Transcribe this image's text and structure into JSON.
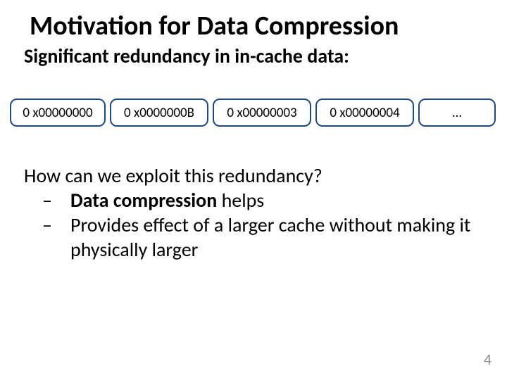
{
  "title": "Motivation for Data Compression",
  "subtitle": "Significant redundancy in in-cache data:",
  "hex_cells": {
    "c0": "0 x00000000",
    "c1": "0 x0000000B",
    "c2": "0 x00000003",
    "c3": "0 x00000004",
    "c4": "…"
  },
  "body": {
    "question": "How can we exploit this redundancy?",
    "bullet1_bold": "Data compression",
    "bullet1_rest": "  helps",
    "bullet2": "Provides effect of a larger cache without making it physically larger",
    "dash": "–"
  },
  "page_number": "4"
}
